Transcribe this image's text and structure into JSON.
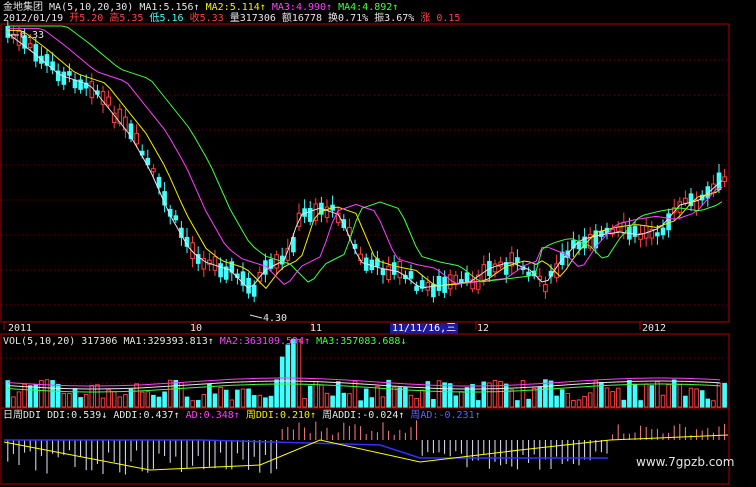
{
  "header": {
    "stock_name": "金地集团",
    "ma_title": "MA(5,10,20,30)",
    "ma1": "MA1:5.156",
    "ma2": "MA2:5.114",
    "ma3": "MA3:4.990",
    "ma4": "MA4:4.892",
    "date": "2012/01/19",
    "open": "开5.20",
    "high": "高5.35",
    "low": "低5.16",
    "close": "收5.33",
    "volume": "量317306",
    "amount": "额16778",
    "turnover": "换0.71%",
    "amplitude": "振3.67%",
    "change": "涨 0.15"
  },
  "price_chart": {
    "high_marker": "6.33",
    "low_marker": "4.30"
  },
  "x_axis": {
    "labels": [
      "2011",
      "10",
      "11",
      "11/11/16,三",
      "12",
      "2012"
    ]
  },
  "volume_panel": {
    "title": "VOL(5,10,20)",
    "value": "317306",
    "ma1": "MA1:329393.813",
    "ma2": "MA2:363109.594",
    "ma3": "MA3:357083.688"
  },
  "ddi_panel": {
    "title": "日周DDI",
    "ddi": "DDI:0.539",
    "addi": "ADDI:0.437",
    "ad": "AD:0.348",
    "week_ddi": "周DDI:0.210",
    "week_addi": "周ADDI:-0.024",
    "week_ad": "周AD:-0.231"
  },
  "watermark": "www.7gpzb.com",
  "colors": {
    "up": "#ff4040",
    "down": "#40ffff",
    "ma1": "#e6e6e6",
    "ma2": "#f0f000",
    "ma3": "#ff40ff",
    "ma4": "#40ff40",
    "frame": "#b00000"
  }
}
